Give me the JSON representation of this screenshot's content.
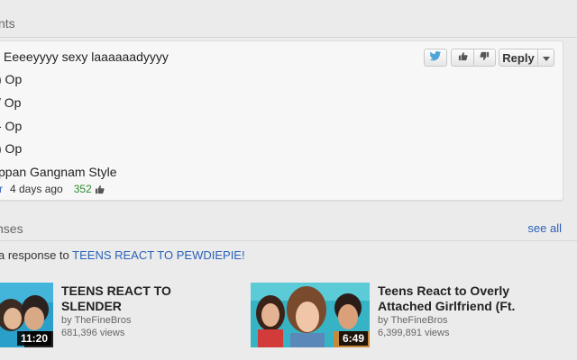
{
  "comments_section": {
    "title": "nts",
    "lines": [
      "Eeeeyyyy sexy laaaaaadyyyy",
      ") Op",
      "/ Op",
      "- Op",
      ") Op",
      "ppan Gangnam Style"
    ],
    "meta": {
      "author": "r",
      "time": "4 days ago",
      "likes": "352"
    },
    "actions": {
      "reply_label": "Reply",
      "icons": [
        "twitter-bird-icon",
        "thumbs-up-icon",
        "thumbs-down-icon",
        "dropdown-arrow-icon"
      ]
    }
  },
  "responses_section": {
    "title": "nses",
    "see_all": "see all",
    "response_prefix": "a response to ",
    "response_link": "TEENS REACT TO PEWDIEPIE!",
    "videos": [
      {
        "title_line1": "TEENS REACT TO",
        "title_line2": "SLENDER",
        "by": "by TheFineBros",
        "views": "681,396 views",
        "duration": "11:20"
      },
      {
        "title_line1": "Teens React to Overly",
        "title_line2": "Attached Girlfriend (Ft.",
        "by": "by TheFineBros",
        "views": "6,399,891 views",
        "duration": "6:49"
      }
    ]
  },
  "colors": {
    "link": "#2a62b8",
    "likes": "#2f8a2f",
    "background": "#ebebeb"
  }
}
